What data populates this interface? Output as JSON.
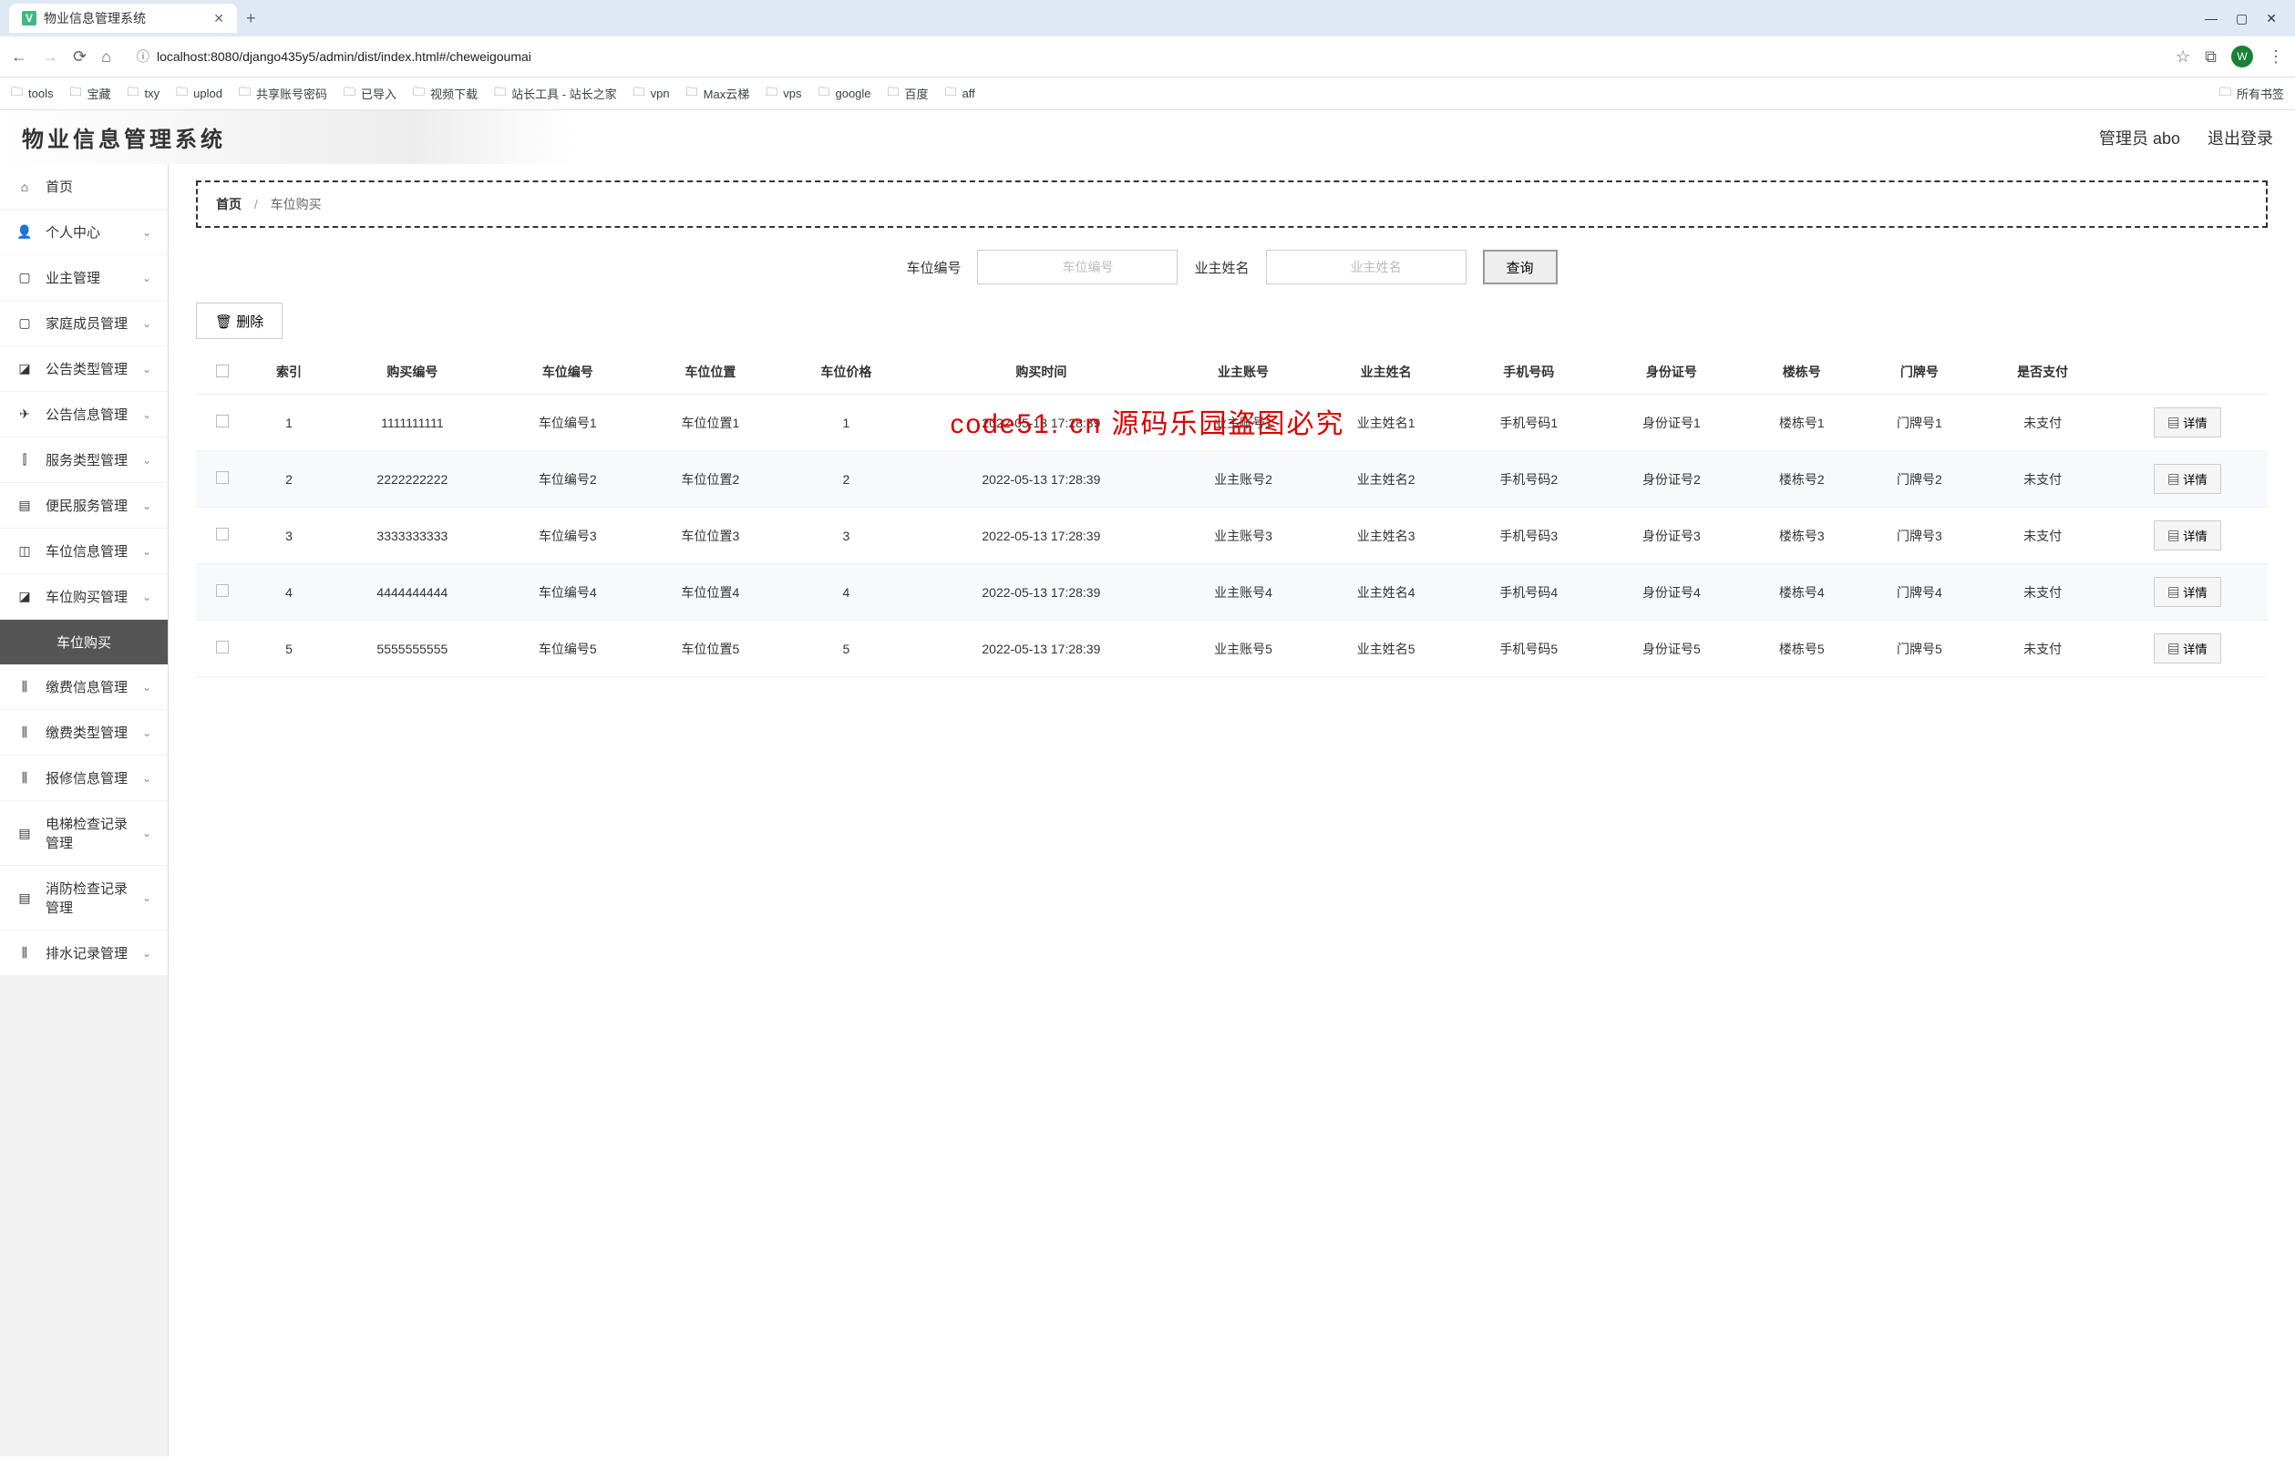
{
  "browser": {
    "tab_title": "物业信息管理系统",
    "url": "localhost:8080/django435y5/admin/dist/index.html#/cheweigoumai",
    "avatar_letter": "W"
  },
  "bookmarks": [
    "tools",
    "宝藏",
    "txy",
    "uplod",
    "共享账号密码",
    "已导入",
    "视频下载",
    "站长工具 - 站长之家",
    "vpn",
    "Max云梯",
    "vps",
    "google",
    "百度",
    "aff"
  ],
  "bookmarks_right": "所有书签",
  "app_title": "物业信息管理系统",
  "header": {
    "admin": "管理员 abo",
    "logout": "退出登录"
  },
  "sidebar": [
    {
      "icon": "⌂",
      "label": "首页",
      "chev": false
    },
    {
      "icon": "👤",
      "label": "个人中心",
      "chev": true
    },
    {
      "icon": "▢",
      "label": "业主管理",
      "chev": true
    },
    {
      "icon": "▢",
      "label": "家庭成员管理",
      "chev": true
    },
    {
      "icon": "◪",
      "label": "公告类型管理",
      "chev": true
    },
    {
      "icon": "✈",
      "label": "公告信息管理",
      "chev": true
    },
    {
      "icon": "⫿",
      "label": "服务类型管理",
      "chev": true
    },
    {
      "icon": "▤",
      "label": "便民服务管理",
      "chev": true
    },
    {
      "icon": "◫",
      "label": "车位信息管理",
      "chev": true
    },
    {
      "icon": "◪",
      "label": "车位购买管理",
      "chev": true,
      "sub": "车位购买"
    },
    {
      "icon": "⫼",
      "label": "缴费信息管理",
      "chev": true
    },
    {
      "icon": "⫼",
      "label": "缴费类型管理",
      "chev": true
    },
    {
      "icon": "⫼",
      "label": "报修信息管理",
      "chev": true
    },
    {
      "icon": "▤",
      "label": "电梯检查记录管理",
      "chev": true
    },
    {
      "icon": "▤",
      "label": "消防检查记录管理",
      "chev": true
    },
    {
      "icon": "⫼",
      "label": "排水记录管理",
      "chev": true
    }
  ],
  "breadcrumb": {
    "home": "首页",
    "current": "车位购买"
  },
  "search": {
    "label1": "车位编号",
    "ph1": "车位编号",
    "label2": "业主姓名",
    "ph2": "业主姓名",
    "query": "查询"
  },
  "delete_btn": "删除",
  "columns": [
    "",
    "索引",
    "购买编号",
    "车位编号",
    "车位位置",
    "车位价格",
    "购买时间",
    "业主账号",
    "业主姓名",
    "手机号码",
    "身份证号",
    "楼栋号",
    "门牌号",
    "是否支付",
    ""
  ],
  "rows": [
    {
      "idx": "1",
      "buyno": "1111111111",
      "cwno": "车位编号1",
      "pos": "车位位置1",
      "price": "1",
      "time": "2022-05-13 17:28:39",
      "acct": "业主账号1",
      "name": "业主姓名1",
      "phone": "手机号码1",
      "idc": "身份证号1",
      "bld": "楼栋号1",
      "door": "门牌号1",
      "paid": "未支付"
    },
    {
      "idx": "2",
      "buyno": "2222222222",
      "cwno": "车位编号2",
      "pos": "车位位置2",
      "price": "2",
      "time": "2022-05-13 17:28:39",
      "acct": "业主账号2",
      "name": "业主姓名2",
      "phone": "手机号码2",
      "idc": "身份证号2",
      "bld": "楼栋号2",
      "door": "门牌号2",
      "paid": "未支付"
    },
    {
      "idx": "3",
      "buyno": "3333333333",
      "cwno": "车位编号3",
      "pos": "车位位置3",
      "price": "3",
      "time": "2022-05-13 17:28:39",
      "acct": "业主账号3",
      "name": "业主姓名3",
      "phone": "手机号码3",
      "idc": "身份证号3",
      "bld": "楼栋号3",
      "door": "门牌号3",
      "paid": "未支付"
    },
    {
      "idx": "4",
      "buyno": "4444444444",
      "cwno": "车位编号4",
      "pos": "车位位置4",
      "price": "4",
      "time": "2022-05-13 17:28:39",
      "acct": "业主账号4",
      "name": "业主姓名4",
      "phone": "手机号码4",
      "idc": "身份证号4",
      "bld": "楼栋号4",
      "door": "门牌号4",
      "paid": "未支付"
    },
    {
      "idx": "5",
      "buyno": "5555555555",
      "cwno": "车位编号5",
      "pos": "车位位置5",
      "price": "5",
      "time": "2022-05-13 17:28:39",
      "acct": "业主账号5",
      "name": "业主姓名5",
      "phone": "手机号码5",
      "idc": "身份证号5",
      "bld": "楼栋号5",
      "door": "门牌号5",
      "paid": "未支付"
    }
  ],
  "detail_btn": "详情",
  "watermark_red": "code51. cn 源码乐园盗图必究",
  "watermark_text": "code51.cn"
}
